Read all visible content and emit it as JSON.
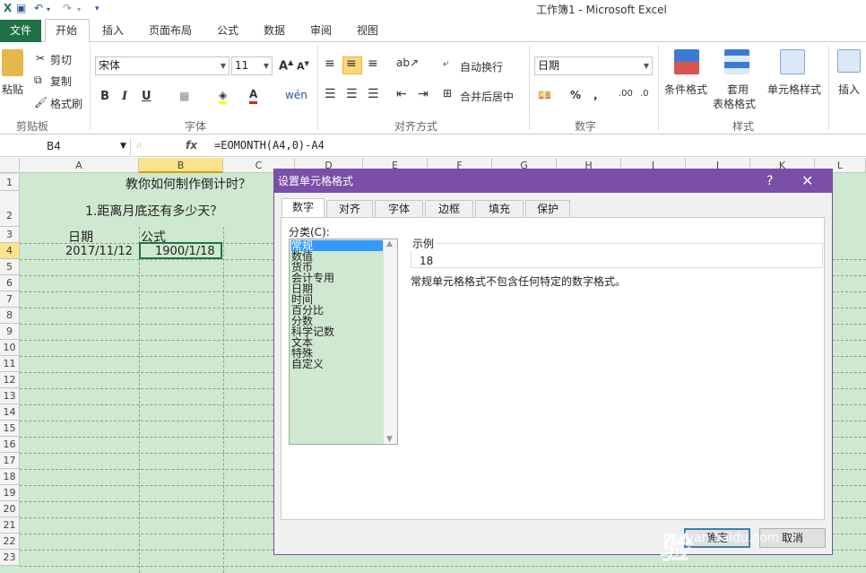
{
  "window": {
    "title": "工作簿1  -  Microsoft Excel"
  },
  "ribbon_tabs": [
    "文件",
    "开始",
    "插入",
    "页面布局",
    "公式",
    "数据",
    "审阅",
    "视图"
  ],
  "ribbon": {
    "clipboard": {
      "paste": "粘贴",
      "cut": "剪切",
      "copy": "复制",
      "format_painter": "格式刷",
      "label": "剪贴板"
    },
    "font": {
      "name": "宋体",
      "size": "11",
      "bold": "B",
      "italic": "I",
      "underline": "U",
      "label": "字体"
    },
    "alignment": {
      "wrap": "自动换行",
      "merge": "合并后居中",
      "label": "对齐方式"
    },
    "number": {
      "format": "日期",
      "percent": "%",
      "comma": ",",
      "label": "数字"
    },
    "styles": {
      "conditional": "条件格式",
      "table_fmt_line1": "套用",
      "table_fmt_line2": "表格格式",
      "cell_styles": "单元格样式",
      "label": "样式"
    },
    "cells": {
      "insert": "插入"
    }
  },
  "formula_bar": {
    "name_box": "B4",
    "fx": "fx",
    "formula": "=EOMONTH(A4,0)-A4"
  },
  "columns": [
    "A",
    "B",
    "C",
    "D",
    "E",
    "F",
    "G",
    "H",
    "I",
    "J",
    "K",
    "L"
  ],
  "rows": [
    "1",
    "2",
    "3",
    "4",
    "5",
    "6",
    "7",
    "8",
    "9",
    "10",
    "11",
    "12",
    "13",
    "14",
    "15",
    "16",
    "17",
    "18",
    "19",
    "20",
    "21",
    "22",
    "23"
  ],
  "cells": {
    "title": "教你如何制作倒计时？",
    "subtitle": "1.距离月底还有多少天？",
    "a3": "日期",
    "b3": "公式",
    "a4": "2017/11/12",
    "b4": "1900/1/18"
  },
  "dialog": {
    "title": "设置单元格格式",
    "help": "?",
    "close": "✕",
    "tabs": [
      "数字",
      "对齐",
      "字体",
      "边框",
      "填充",
      "保护"
    ],
    "category_label": "分类(C):",
    "categories": [
      "常规",
      "数值",
      "货币",
      "会计专用",
      "日期",
      "时间",
      "百分比",
      "分数",
      "科学记数",
      "文本",
      "特殊",
      "自定义"
    ],
    "selected_category": "常规",
    "sample_label": "示例",
    "sample_value": "18",
    "description": "常规单元格格式不包含任何特定的数字格式。",
    "ok": "确定",
    "cancel": "取消"
  },
  "watermark": {
    "text": "Bai du 经验",
    "sub": "jingyan.baidu.com"
  },
  "colors": {
    "excel_green": "#217346",
    "file_tab": "#1e7145",
    "dialog_title": "#7b4fa8",
    "sheet_fill": "#cfe8d0",
    "selected_header": "#ffe38a",
    "list_selected": "#3399ff"
  }
}
